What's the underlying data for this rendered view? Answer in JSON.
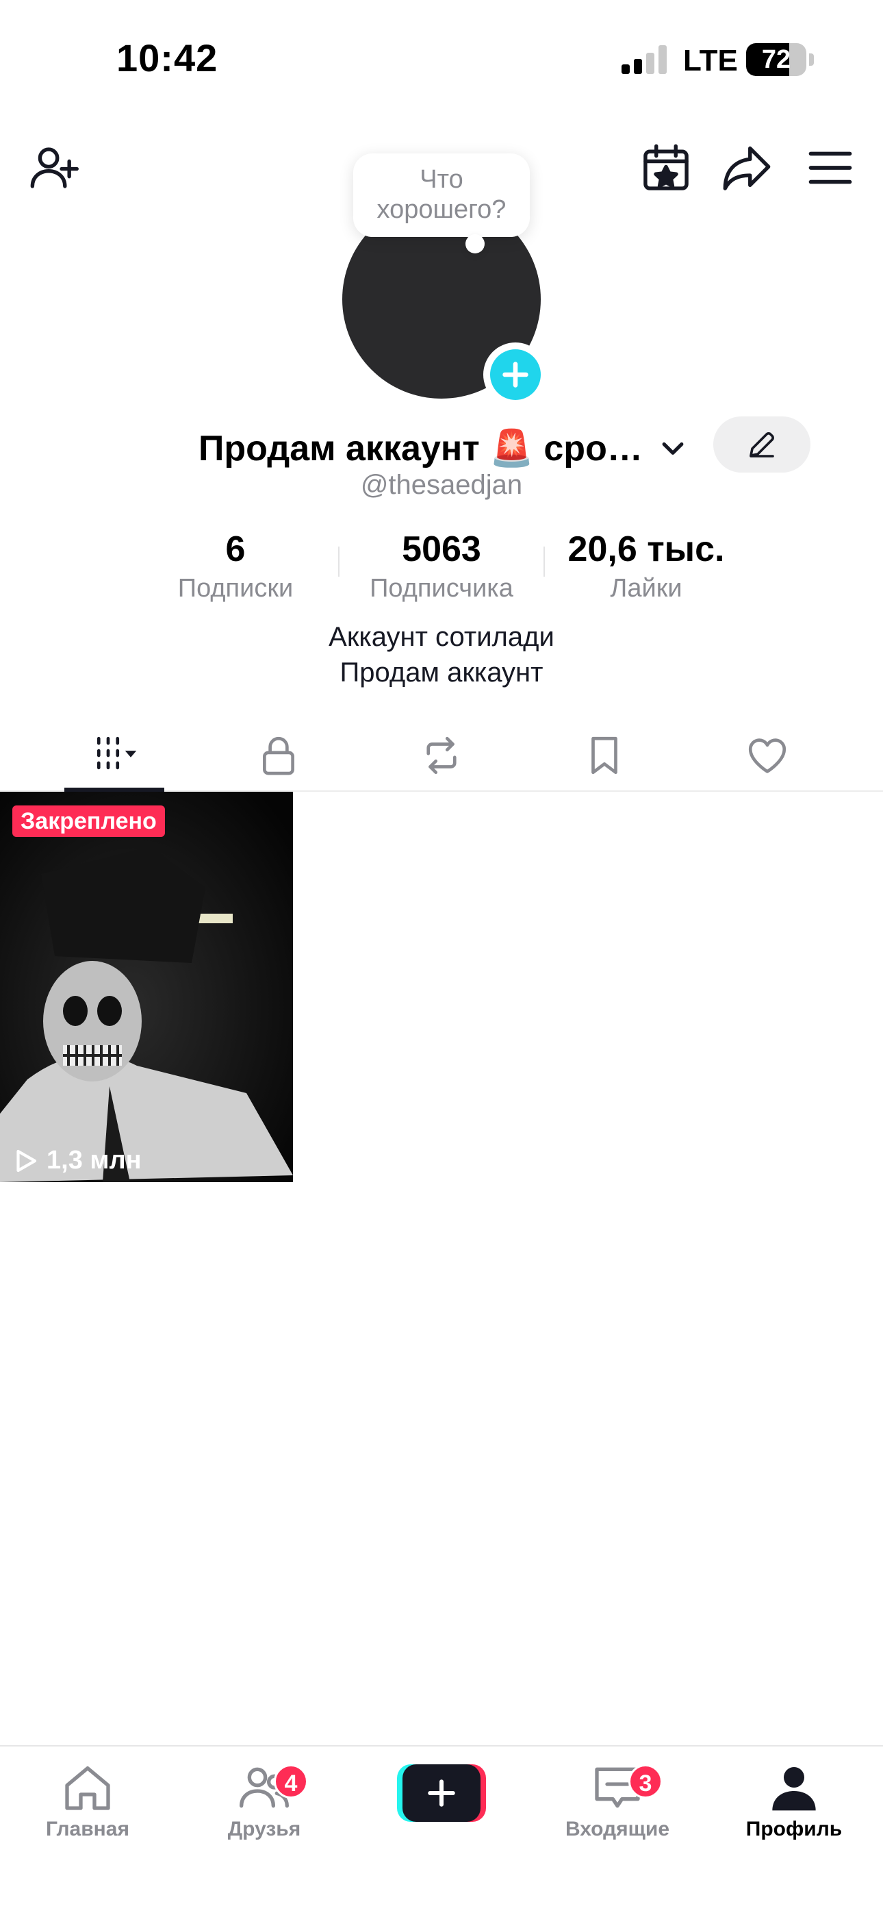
{
  "status_bar": {
    "time": "10:42",
    "network": "LTE",
    "battery": 72
  },
  "header": {
    "icons": [
      "add-friend-icon",
      "calendar-star-icon",
      "share-icon",
      "menu-icon"
    ]
  },
  "bubble": {
    "text_line1": "Что",
    "text_line2": "хорошего?"
  },
  "profile": {
    "name": "Продам аккаунт 🚨 сро…",
    "username": "@thesaedjan",
    "bio_line1": "Аккаунт сотилади",
    "bio_line2": "Продам аккаунт"
  },
  "stats": [
    {
      "value": "6",
      "label": "Подписки"
    },
    {
      "value": "5063",
      "label": "Подписчика"
    },
    {
      "value": "20,6 тыс.",
      "label": "Лайки"
    }
  ],
  "tabs": [
    "videos-grid-icon",
    "lock-icon",
    "repost-icon",
    "bookmark-icon",
    "heart-icon"
  ],
  "videos": [
    {
      "pinned_label": "Закреплено",
      "views": "1,3 млн"
    }
  ],
  "nav": {
    "home": "Главная",
    "friends": "Друзья",
    "friends_badge": "4",
    "inbox": "Входящие",
    "inbox_badge": "3",
    "profile": "Профиль"
  },
  "colors": {
    "accent_red": "#fe2c55",
    "accent_cyan": "#20d5ec",
    "text_secondary": "#8a8b91"
  }
}
